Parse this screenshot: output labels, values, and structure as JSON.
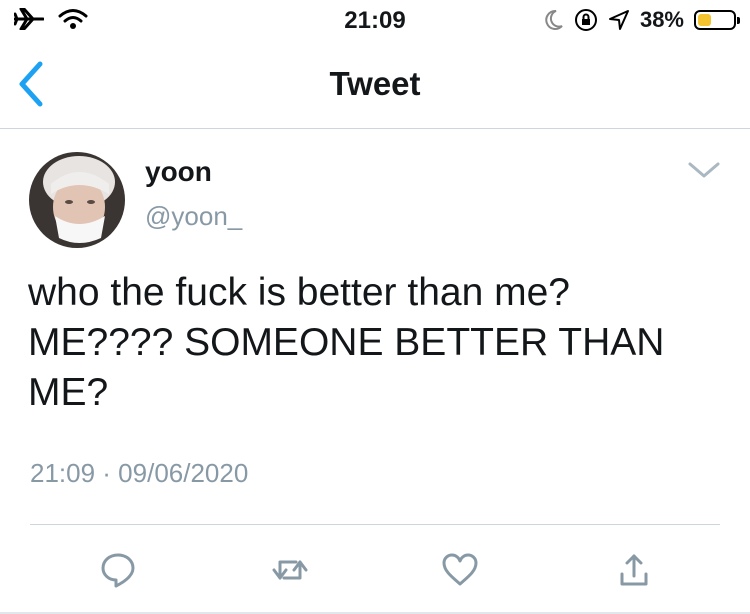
{
  "status_bar": {
    "time": "21:09",
    "battery_percent": "38%",
    "battery_level": 0.38,
    "icons": [
      "airplane-icon",
      "wifi-icon",
      "moon-icon",
      "rotation-lock-icon",
      "location-icon",
      "battery-icon"
    ],
    "battery_color": "#f4c430"
  },
  "nav": {
    "title": "Tweet",
    "back_icon": "chevron-left-icon",
    "accent_color": "#1da1f2"
  },
  "tweet": {
    "display_name": "yoon",
    "handle": "@yoon_",
    "text": "who the fuck is better than me? ME???? SOMEONE BETTER THAN ME?",
    "timestamp": "21:09 · 09/06/2020",
    "menu_icon": "chevron-down-icon"
  },
  "actions": [
    {
      "icon": "reply-icon"
    },
    {
      "icon": "retweet-icon"
    },
    {
      "icon": "like-icon"
    },
    {
      "icon": "share-icon"
    }
  ]
}
